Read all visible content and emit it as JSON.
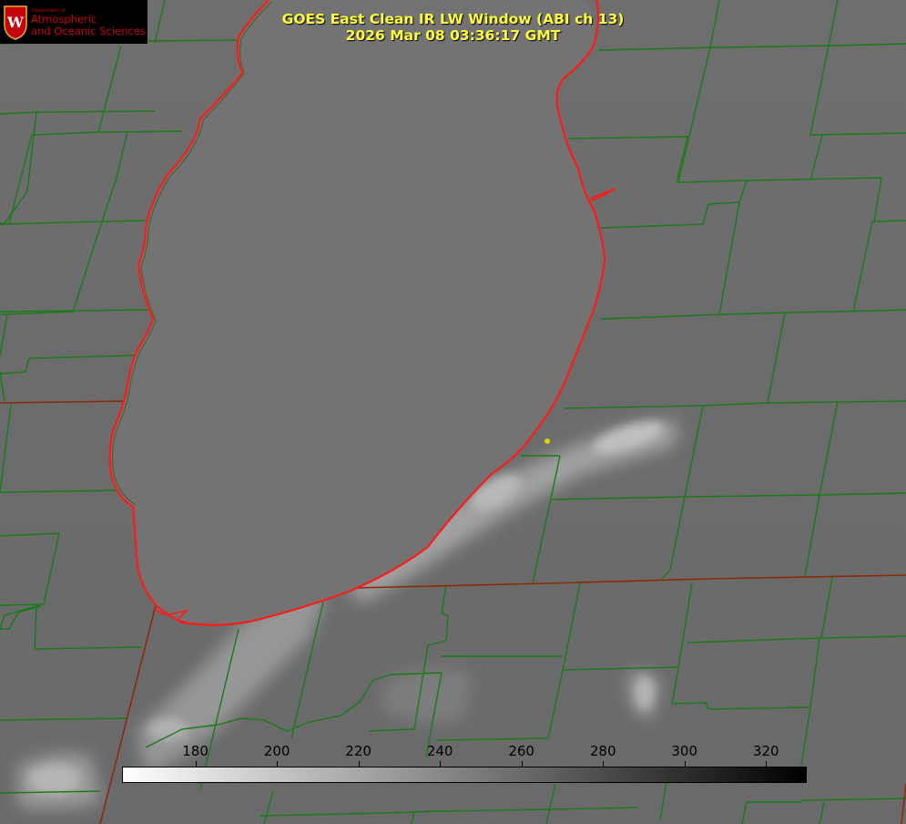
{
  "title": {
    "line1": "GOES East Clean IR LW Window (ABI ch 13)",
    "line2": "2026 Mar 08 03:36:17 GMT"
  },
  "logo": {
    "department_prefix": "Department of",
    "line1": "Atmospheric",
    "line2": "and Oceanic Sciences",
    "crest_letter": "W",
    "color": "#c5050c"
  },
  "colorbar": {
    "ticks": [
      "180",
      "200",
      "220",
      "240",
      "260",
      "280",
      "300",
      "320"
    ],
    "range_min": 162,
    "range_max": 330,
    "gradient": [
      "#ffffff",
      "#000000"
    ]
  },
  "map_colors": {
    "county_lines": "#1a7a1a",
    "state_lines": "#8b2a0a",
    "lake_shoreline": "#ff1a1a",
    "station_dot": "#e0d000"
  }
}
